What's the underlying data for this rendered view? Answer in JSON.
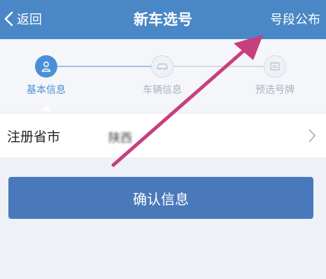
{
  "nav": {
    "back_label": "返回",
    "title": "新车选号",
    "right_action": "号段公布"
  },
  "steps": [
    {
      "label": "基本信息",
      "icon": "person-icon",
      "state": "active"
    },
    {
      "label": "车辆信息",
      "icon": "car-icon",
      "state": "inactive"
    },
    {
      "label": "预选号牌",
      "icon": "plate-icon",
      "state": "inactive"
    }
  ],
  "form": {
    "field_label": "注册省市",
    "field_value": "陕西"
  },
  "confirm_label": "确认信息",
  "colors": {
    "nav_bg": "#4a87c6",
    "active_step": "#4a90d8",
    "inactive_step": "#b9c7d6",
    "button_bg": "#4a79bb",
    "annotation_arrow": "#c83f7f"
  }
}
